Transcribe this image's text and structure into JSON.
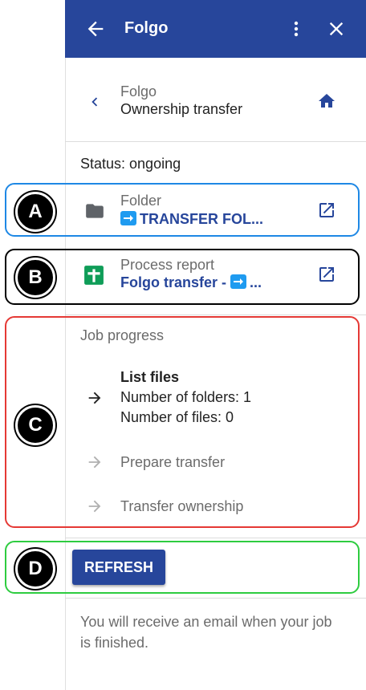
{
  "header": {
    "title": "Folgo",
    "color": "#27469b",
    "back_icon": "arrow-left-icon",
    "more_icon": "more-vert-icon",
    "close_icon": "close-icon"
  },
  "nav": {
    "parent": "Folgo",
    "title": "Ownership transfer",
    "back_icon": "chevron-left-icon",
    "home_icon": "home-icon"
  },
  "status_text": "Status: ongoing",
  "folder": {
    "label": "Folder",
    "value": "TRANSFER FOL...",
    "icon": "folder-icon",
    "open_icon": "open-in-new-icon"
  },
  "report": {
    "label": "Process report",
    "value_prefix": "Folgo transfer - ",
    "value_suffix": "...",
    "icon": "sheets-icon",
    "open_icon": "open-in-new-icon"
  },
  "job": {
    "label": "Job progress",
    "steps": [
      {
        "title": "List files",
        "details": [
          "Number of folders: 1",
          "Number of files: 0"
        ],
        "state": "active"
      },
      {
        "title": "Prepare transfer",
        "details": [],
        "state": "pending"
      },
      {
        "title": "Transfer ownership",
        "details": [],
        "state": "pending"
      }
    ]
  },
  "refresh_label": "REFRESH",
  "footer_note": "You will receive an email when your job is finished.",
  "callouts": [
    {
      "letter": "A",
      "color": "#1e88e5"
    },
    {
      "letter": "B",
      "color": "#000000"
    },
    {
      "letter": "C",
      "color": "#e53935"
    },
    {
      "letter": "D",
      "color": "#2ecc40"
    }
  ]
}
